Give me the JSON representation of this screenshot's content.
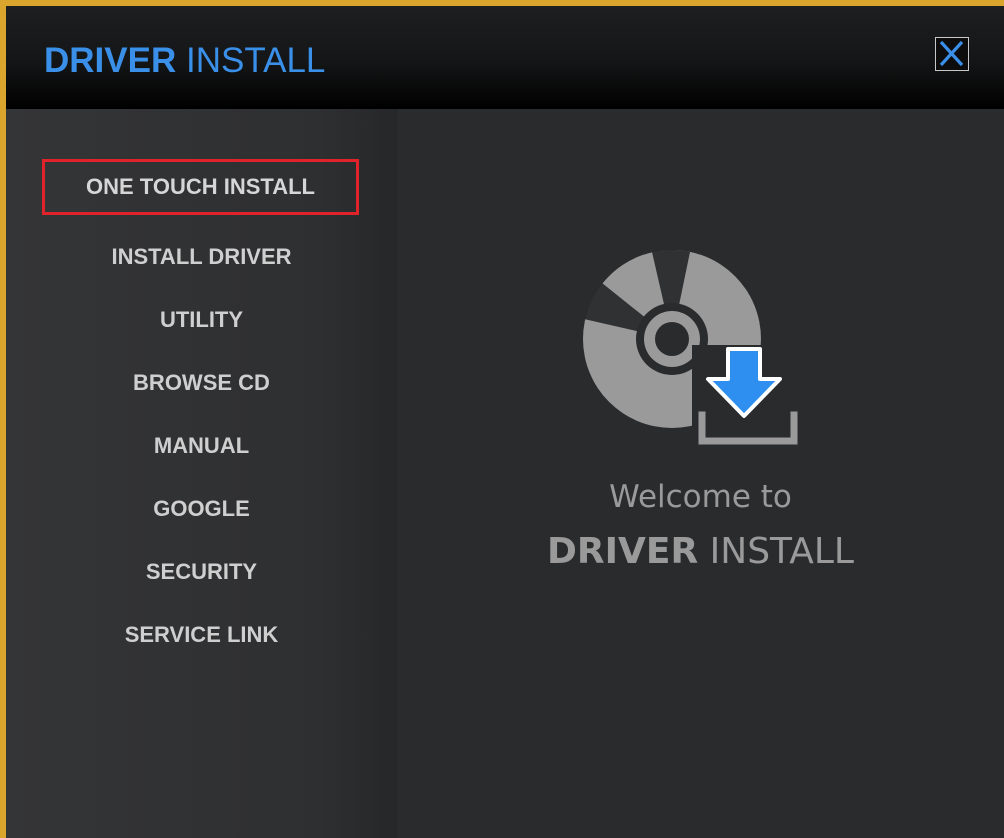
{
  "app": {
    "title_bold": "DRIVER",
    "title_light": "INSTALL",
    "accent_color": "#3a8fe8",
    "border_color": "#d9a52c"
  },
  "titlebar": {
    "close_icon": "close-icon"
  },
  "sidebar": {
    "items": [
      {
        "label": "ONE TOUCH INSTALL",
        "highlighted": true
      },
      {
        "label": "INSTALL DRIVER"
      },
      {
        "label": "UTILITY"
      },
      {
        "label": "BROWSE CD"
      },
      {
        "label": "MANUAL"
      },
      {
        "label": "GOOGLE"
      },
      {
        "label": "SECURITY"
      },
      {
        "label": "SERVICE LINK"
      }
    ],
    "highlight_color": "#e0222a"
  },
  "main": {
    "icon": "disc-download-icon",
    "welcome_line": "Welcome to",
    "welcome_bold": "DRIVER",
    "welcome_light": "INSTALL"
  }
}
